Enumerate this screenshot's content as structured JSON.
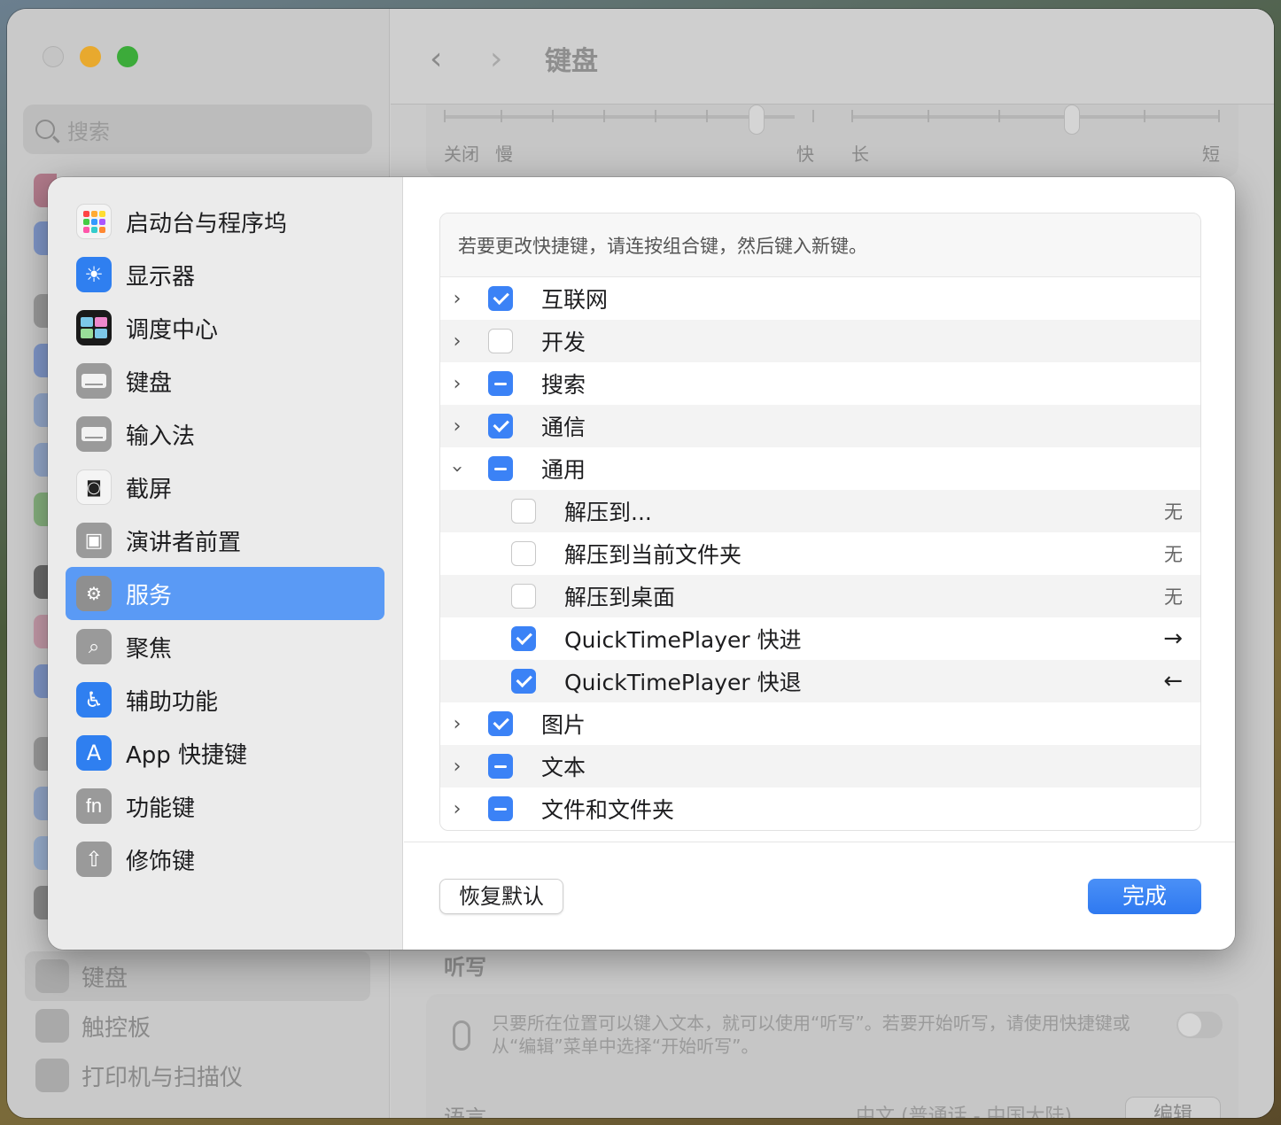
{
  "window": {
    "title": "键盘",
    "search_placeholder": "搜索",
    "bg_sidebar": [
      {
        "label": "键盘",
        "selected": true
      },
      {
        "label": "触控板",
        "selected": false
      },
      {
        "label": "打印机与扫描仪",
        "selected": false
      }
    ],
    "slider": {
      "repeat_labels": [
        "关闭",
        "慢",
        "快"
      ],
      "delay_labels": [
        "长",
        "短"
      ]
    },
    "dictation": {
      "title": "听写",
      "description": "只要所在位置可以键入文本，就可以使用“听写”。若要开始听写，请使用快捷键或从“编辑”菜单中选择“开始听写”。",
      "language_label": "语言",
      "language_value": "中文 (普通话 - 中国大陆)",
      "edit_label": "编辑"
    }
  },
  "sheet": {
    "sidebar": [
      {
        "label": "启动台与程序坞",
        "icon": "launchpad-icon"
      },
      {
        "label": "显示器",
        "icon": "display-icon"
      },
      {
        "label": "调度中心",
        "icon": "mission-control-icon"
      },
      {
        "label": "键盘",
        "icon": "keyboard-icon"
      },
      {
        "label": "输入法",
        "icon": "input-method-icon"
      },
      {
        "label": "截屏",
        "icon": "screenshot-icon"
      },
      {
        "label": "演讲者前置",
        "icon": "presenter-overlay-icon"
      },
      {
        "label": "服务",
        "icon": "services-icon",
        "selected": true
      },
      {
        "label": "聚焦",
        "icon": "spotlight-icon"
      },
      {
        "label": "辅助功能",
        "icon": "accessibility-icon"
      },
      {
        "label": "App 快捷键",
        "icon": "app-shortcuts-icon"
      },
      {
        "label": "功能键",
        "icon": "fn-key-icon",
        "glyph": "fn"
      },
      {
        "label": "修饰键",
        "icon": "modifier-keys-icon"
      }
    ],
    "hint": "若要更改快捷键，请连按组合键，然后键入新键。",
    "rows": [
      {
        "label": "互联网",
        "state": "checked",
        "level": 0,
        "expandable": true,
        "expanded": false,
        "shortcut": ""
      },
      {
        "label": "开发",
        "state": "unchecked",
        "level": 0,
        "expandable": true,
        "expanded": false,
        "shortcut": ""
      },
      {
        "label": "搜索",
        "state": "mixed",
        "level": 0,
        "expandable": true,
        "expanded": false,
        "shortcut": ""
      },
      {
        "label": "通信",
        "state": "checked",
        "level": 0,
        "expandable": true,
        "expanded": false,
        "shortcut": ""
      },
      {
        "label": "通用",
        "state": "mixed",
        "level": 0,
        "expandable": true,
        "expanded": true,
        "shortcut": ""
      },
      {
        "label": "解压到...",
        "state": "unchecked",
        "level": 1,
        "expandable": false,
        "shortcut": "无"
      },
      {
        "label": "解压到当前文件夹",
        "state": "unchecked",
        "level": 1,
        "expandable": false,
        "shortcut": "无"
      },
      {
        "label": "解压到桌面",
        "state": "unchecked",
        "level": 1,
        "expandable": false,
        "shortcut": "无"
      },
      {
        "label": "QuickTimePlayer 快进",
        "state": "checked",
        "level": 1,
        "expandable": false,
        "shortcut": "→"
      },
      {
        "label": "QuickTimePlayer 快退",
        "state": "checked",
        "level": 1,
        "expandable": false,
        "shortcut": "←"
      },
      {
        "label": "图片",
        "state": "checked",
        "level": 0,
        "expandable": true,
        "expanded": false,
        "shortcut": ""
      },
      {
        "label": "文本",
        "state": "mixed",
        "level": 0,
        "expandable": true,
        "expanded": false,
        "shortcut": ""
      },
      {
        "label": "文件和文件夹",
        "state": "mixed",
        "level": 0,
        "expandable": true,
        "expanded": false,
        "shortcut": ""
      }
    ],
    "restore_label": "恢复默认",
    "done_label": "完成"
  },
  "colors": {
    "accent": "#3b82f6",
    "selection": "#5a9af5"
  }
}
